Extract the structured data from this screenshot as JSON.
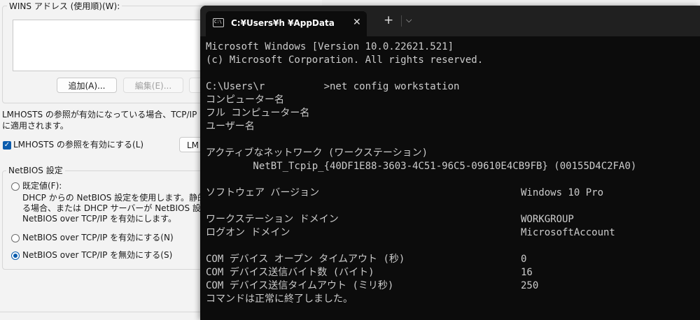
{
  "dialog": {
    "wins_group_title": "WINS アドレス (使用順)(W):",
    "wins_buttons": {
      "add": "追加(A)...",
      "edit": "編集(E)..."
    },
    "lmhosts_desc_1": "LMHOSTS の参照が有効になっている場合、TCP/IP が使用",
    "lmhosts_desc_2": "に適用されます。",
    "lmhosts_checkbox": "LMHOSTS の参照を有効にする(L)",
    "lmhosts_button": "LM",
    "netbios_group_title": "NetBIOS 設定",
    "radio_default_label": "既定値(F):",
    "radio_default_desc_1": "DHCP からの NetBIOS 設定を使用します。静的 IP",
    "radio_default_desc_2": "る場合、または DHCP サーバーが NetBIOS 設定を提",
    "radio_default_desc_3": "NetBIOS over TCP/IP を有効にします。",
    "radio_enable_label": "NetBIOS over TCP/IP を有効にする(N)",
    "radio_disable_label": "NetBIOS over TCP/IP を無効にする(S)",
    "selected_radio": "disable"
  },
  "terminal": {
    "tab_icon_text": "C:\\",
    "tab_title": "C:¥Users¥h            ¥AppData",
    "close_glyph": "✕",
    "new_tab_glyph": "+",
    "dropdown_glyph": "⌵",
    "lines": [
      {
        "label": "Microsoft Windows [Version 10.0.22621.521]",
        "value": ""
      },
      {
        "label": "(c) Microsoft Corporation. All rights reserved.",
        "value": ""
      },
      {
        "label": "",
        "value": ""
      },
      {
        "label": "C:\\Users\\r          >net config workstation",
        "value": ""
      },
      {
        "label": "コンピューター名",
        "value": ""
      },
      {
        "label": "フル コンピューター名",
        "value": ""
      },
      {
        "label": "ユーザー名",
        "value": ""
      },
      {
        "label": "",
        "value": ""
      },
      {
        "label": "アクティブなネットワーク (ワークステーション)",
        "value": ""
      },
      {
        "label": "        NetBT_Tcpip_{40DF1E88-3603-4C51-96C5-09610E4CB9FB} (00155D4C2FA0)",
        "value": ""
      },
      {
        "label": "",
        "value": ""
      },
      {
        "label": "ソフトウェア バージョン",
        "value": "Windows 10 Pro"
      },
      {
        "label": "",
        "value": ""
      },
      {
        "label": "ワークステーション ドメイン",
        "value": "WORKGROUP"
      },
      {
        "label": "ログオン ドメイン",
        "value": "MicrosoftAccount"
      },
      {
        "label": "",
        "value": ""
      },
      {
        "label": "COM デバイス オープン タイムアウト (秒)",
        "value": "0"
      },
      {
        "label": "COM デバイス送信バイト数 (バイト)",
        "value": "16"
      },
      {
        "label": "COM デバイス送信タイムアウト (ミリ秒)",
        "value": "250"
      },
      {
        "label": "コマンドは正常に終了しました。",
        "value": ""
      }
    ]
  },
  "colors": {
    "terminal_bg": "#0c0c0c",
    "terminal_text": "#cccccc",
    "titlebar_bg": "#202020",
    "accent": "#0b5cad"
  }
}
